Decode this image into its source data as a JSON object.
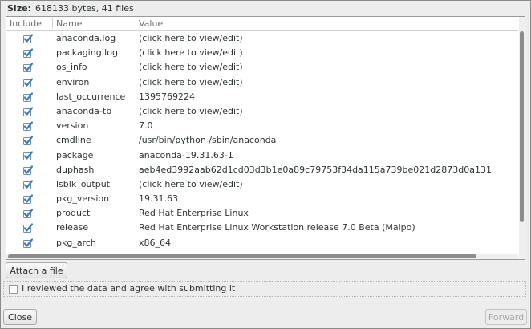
{
  "size": {
    "label": "Size:",
    "value": "618133 bytes, 41 files"
  },
  "table": {
    "headers": {
      "include": "Include",
      "name": "Name",
      "value": "Value"
    },
    "rows": [
      {
        "include": true,
        "name": "anaconda.log",
        "value": "(click here to view/edit)"
      },
      {
        "include": true,
        "name": "packaging.log",
        "value": "(click here to view/edit)"
      },
      {
        "include": true,
        "name": "os_info",
        "value": "(click here to view/edit)"
      },
      {
        "include": true,
        "name": "environ",
        "value": "(click here to view/edit)"
      },
      {
        "include": true,
        "name": "last_occurrence",
        "value": "1395769224"
      },
      {
        "include": true,
        "name": "anaconda-tb",
        "value": "(click here to view/edit)"
      },
      {
        "include": true,
        "name": "version",
        "value": "7.0"
      },
      {
        "include": true,
        "name": "cmdline",
        "value": "/usr/bin/python  /sbin/anaconda"
      },
      {
        "include": true,
        "name": "package",
        "value": "anaconda-19.31.63-1"
      },
      {
        "include": true,
        "name": "duphash",
        "value": "aeb4ed3992aab62d1cd03d3b1e0a89c79753f34da115a739be021d2873d0a131"
      },
      {
        "include": true,
        "name": "lsblk_output",
        "value": "(click here to view/edit)"
      },
      {
        "include": true,
        "name": "pkg_version",
        "value": "19.31.63"
      },
      {
        "include": true,
        "name": "product",
        "value": "Red Hat Enterprise Linux"
      },
      {
        "include": true,
        "name": "release",
        "value": "Red Hat Enterprise Linux Workstation release 7.0 Beta (Maipo)"
      },
      {
        "include": true,
        "name": "pkg_arch",
        "value": "x86_64"
      }
    ]
  },
  "buttons": {
    "attach": "Attach a file",
    "close": "Close",
    "forward": "Forward"
  },
  "agree": {
    "checked": false,
    "label": "I reviewed the data and agree with submitting it"
  },
  "colors": {
    "checkbox_blue": "#3b7dc4",
    "checkbox_border": "#6f8fb3"
  }
}
